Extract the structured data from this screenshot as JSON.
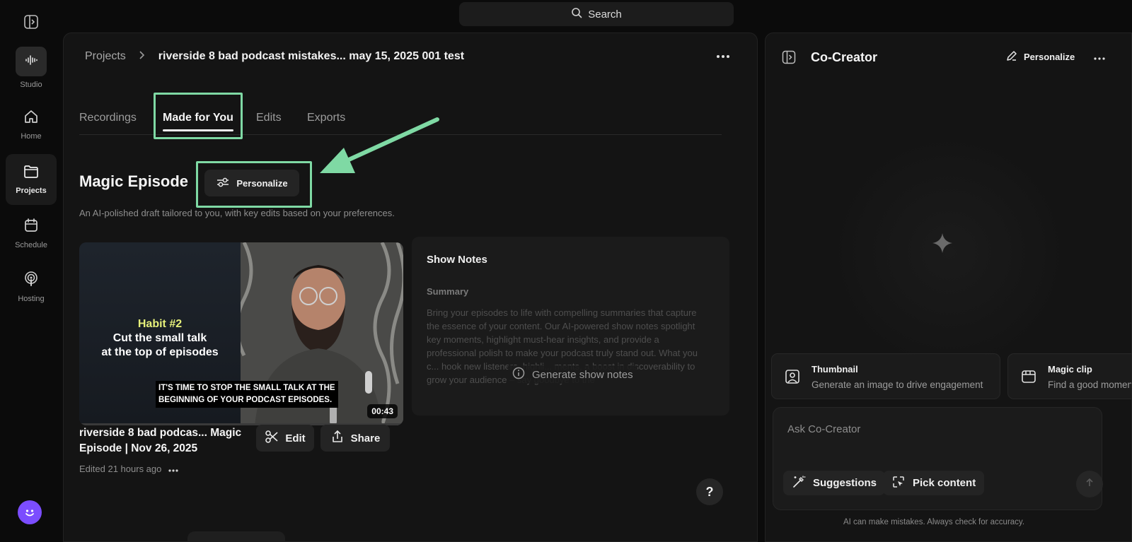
{
  "search": {
    "label": "Search"
  },
  "sidebar": {
    "items": [
      {
        "label": "Studio",
        "icon": "waveform-icon"
      },
      {
        "label": "Home",
        "icon": "home-icon"
      },
      {
        "label": "Projects",
        "icon": "folder-icon",
        "active": true
      },
      {
        "label": "Schedule",
        "icon": "calendar-icon"
      },
      {
        "label": "Hosting",
        "icon": "podcast-icon"
      }
    ]
  },
  "breadcrumb": {
    "root": "Projects",
    "current": "riverside 8 bad podcast mistakes... may 15, 2025 001 test"
  },
  "tabs": [
    {
      "label": "Recordings"
    },
    {
      "label": "Made for You",
      "active": true
    },
    {
      "label": "Edits"
    },
    {
      "label": "Exports"
    }
  ],
  "magic": {
    "title": "Magic Episode",
    "personalize_label": "Personalize",
    "subtitle": "An AI-polished draft tailored to you, with key edits based on your preferences."
  },
  "video": {
    "overlay_line1": "Habit #2",
    "overlay_line2": "Cut the small talk",
    "overlay_line3": "at the top of episodes",
    "caption_line1": "IT'S TIME TO STOP THE SMALL TALK AT THE",
    "caption_line2": "BEGINNING OF YOUR PODCAST EPISODES.",
    "duration": "00:43"
  },
  "episode": {
    "title": "riverside 8 bad podcas... Magic Episode | Nov 26, 2025",
    "edited": "Edited 21 hours ago",
    "edit_label": "Edit",
    "share_label": "Share"
  },
  "show_notes": {
    "title": "Show Notes",
    "summary_label": "Summary",
    "body": "Bring your episodes to life with compelling summaries that capture the essence of your content. Our AI-powered show notes spotlight key moments, highlight must-hear insights, and provide a professional polish to make your podcast truly stand out. What you c... hook new listeners, highli... ments, a boost in discoverability to grow your audience – say goodbye to the",
    "generate_label": "Generate show notes"
  },
  "help": {
    "label": "?"
  },
  "cocreator": {
    "title": "Co-Creator",
    "personalize_label": "Personalize",
    "cards": [
      {
        "title": "Thumbnail",
        "desc": "Generate an image to drive engagement",
        "icon": "thumbnail-icon"
      },
      {
        "title": "Magic clip",
        "desc": "Find a good moment",
        "icon": "clip-icon"
      }
    ],
    "ask_placeholder": "Ask Co-Creator",
    "suggestions_label": "Suggestions",
    "pick_content_label": "Pick content",
    "disclaimer": "AI can make mistakes. Always check for accuracy."
  },
  "colors": {
    "highlight": "#7fd9a4",
    "avatar": "#7b4dff",
    "background": "#0b0b0b",
    "panel": "#141414"
  }
}
